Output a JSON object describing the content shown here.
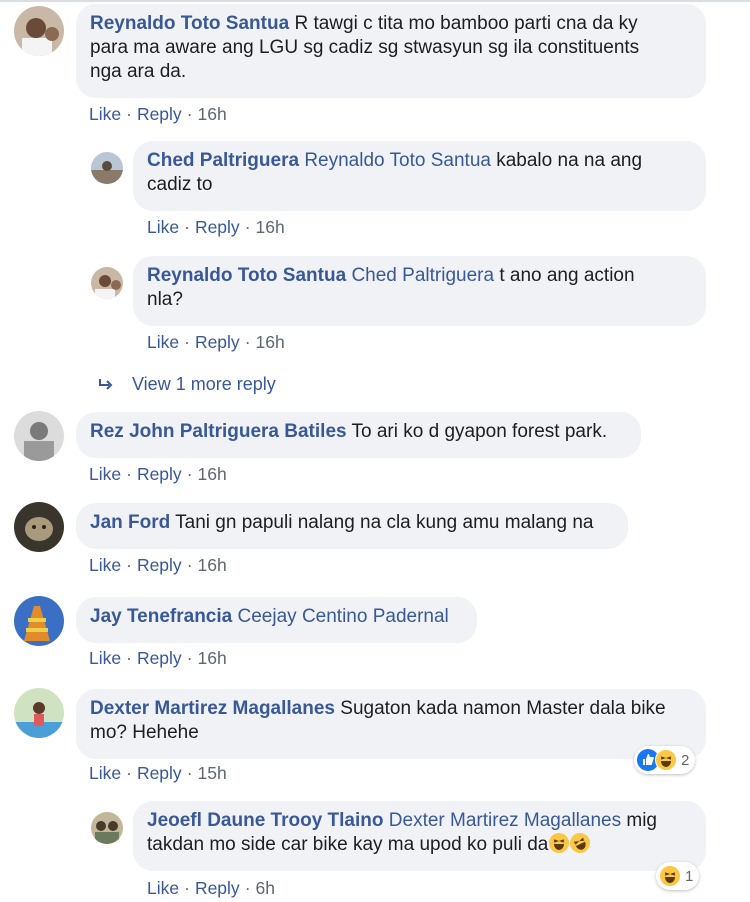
{
  "comments": [
    {
      "author": "Reynaldo Toto Santua",
      "mention": "",
      "text_lines": [
        "R tawgi c tita mo bamboo parti cna da ky",
        "para ma aware ang LGU sg cadiz sg stwasyun sg ila constituents",
        "nga ara da."
      ],
      "like": "Like",
      "reply": "Reply",
      "time": "16h"
    },
    {
      "author": "Ched Paltriguera",
      "mention": "Reynaldo Toto Santua",
      "text": "kabalo na na ang",
      "text_line2": "cadiz to",
      "like": "Like",
      "reply": "Reply",
      "time": "16h"
    },
    {
      "author": "Reynaldo Toto Santua",
      "mention": "Ched Paltriguera",
      "text": "t ano ang action",
      "text_line2": "nla?",
      "like": "Like",
      "reply": "Reply",
      "time": "16h"
    },
    {
      "author": "Rez John Paltriguera Batiles",
      "text": "To ari ko d gyapon forest park.",
      "like": "Like",
      "reply": "Reply",
      "time": "16h"
    },
    {
      "author": "Jan Ford",
      "text": "Tani gn papuli nalang na cla kung amu malang na",
      "like": "Like",
      "reply": "Reply",
      "time": "16h"
    },
    {
      "author": "Jay Tenefrancia",
      "mention": "Ceejay Centino Padernal",
      "like": "Like",
      "reply": "Reply",
      "time": "16h"
    },
    {
      "author": "Dexter Martirez Magallanes",
      "text": "Sugaton kada namon Master dala bike",
      "text_line2": "mo? Hehehe",
      "like": "Like",
      "reply": "Reply",
      "time": "15h",
      "reaction_count": "2"
    },
    {
      "author": "Jeoefl Daune Trooy Tlaino",
      "mention": "Dexter Martirez Magallanes",
      "text": "mig",
      "text_line2": "takdan mo side car bike kay ma upod ko puli da",
      "like": "Like",
      "reply": "Reply",
      "time": "6h",
      "reaction_count": "1"
    }
  ],
  "view_more": "View 1 more reply",
  "sep": "·",
  "colors": {
    "link": "#385898",
    "bubble": "#f0f2f5",
    "meta": "#606770",
    "like_blue": "#1877f2",
    "haha_yellow": "#fcc744"
  },
  "icons": {
    "reply_arrow": "reply-arrow-icon",
    "like": "like-reaction-icon",
    "haha": "haha-reaction-icon"
  }
}
